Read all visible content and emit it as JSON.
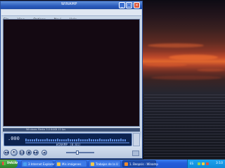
{
  "window": {
    "title": "WINAMP",
    "menu": [
      "File",
      "View",
      "Options",
      "Navi",
      "Help"
    ],
    "minimize_glyph": "_",
    "maximize_glyph": "□",
    "close_glyph": "×"
  },
  "video": {
    "status_text": "Windows Media 3.0 64KB 15 fps"
  },
  "player": {
    "time": ".000",
    "info_text": "WINAMP (0:01)",
    "controls": [
      "previous",
      "play",
      "pause",
      "stop",
      "next",
      "open"
    ],
    "volume_level": 0.4
  },
  "taskbar": {
    "start_label": "Inicio",
    "tasks": [
      {
        "label": "3 Internet Explorer",
        "icon": "ie-icon",
        "color": "#4aa0f0"
      },
      {
        "label": "Mis imágenes",
        "icon": "folder-icon",
        "color": "#f0c84a"
      },
      {
        "label": "Trabajos de la U",
        "icon": "folder-icon",
        "color": "#f0c84a"
      },
      {
        "label": "1. Beopsis - Winamp",
        "icon": "winamp-icon",
        "color": "#f08a2a",
        "active": true
      }
    ],
    "tray_language": "ES",
    "clock": "3:10"
  },
  "colors": {
    "accent": "#245edb",
    "start": "#3c9a3a",
    "display": "#0c2350"
  }
}
